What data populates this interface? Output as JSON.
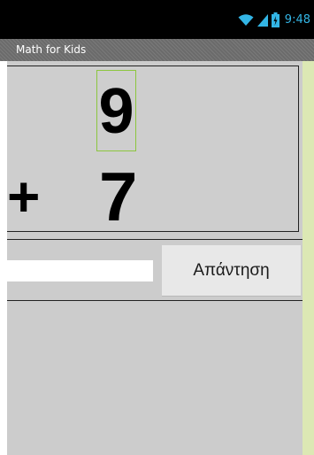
{
  "status_bar": {
    "time": "9:48",
    "icons": [
      "wifi-icon",
      "signal-icon",
      "battery-icon"
    ]
  },
  "app": {
    "title": "Math for Kids"
  },
  "problem": {
    "top_number": "9",
    "operator": "+",
    "bottom_number": "7"
  },
  "answer": {
    "input_value": "",
    "button_label": "Απάντηση"
  },
  "colors": {
    "status_bar": "#000000",
    "status_accent": "#33b5e5",
    "screen_bg": "#cccccc",
    "highlight_border": "#8cc63f",
    "side_strip": "#dce8b4"
  }
}
